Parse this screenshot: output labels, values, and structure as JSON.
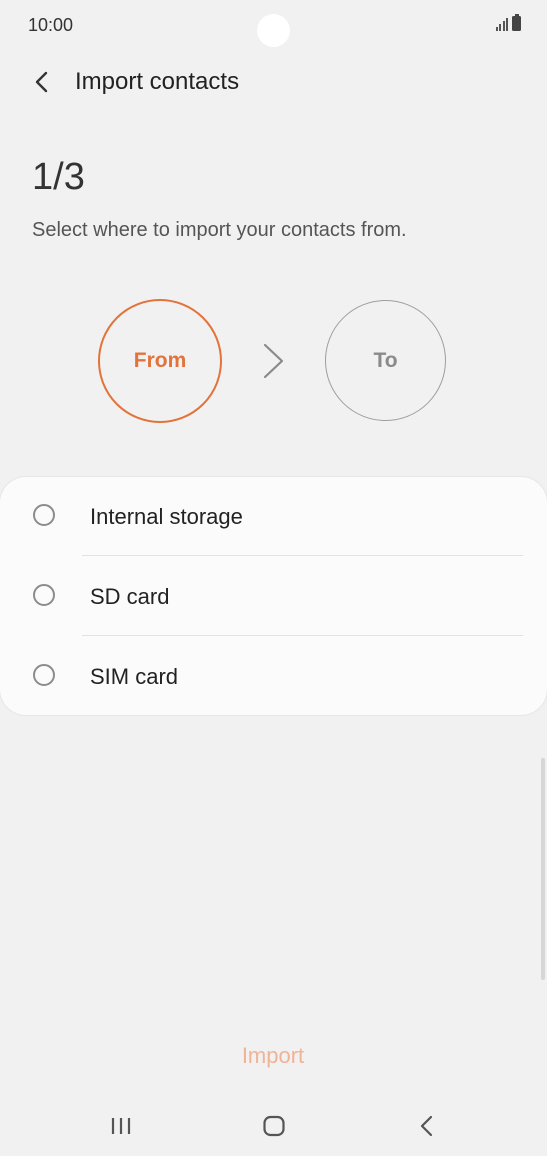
{
  "status_bar": {
    "time": "10:00",
    "signal_icon": "signal-bars-icon",
    "battery_icon": "battery-icon"
  },
  "header": {
    "title": "Import contacts",
    "back_icon": "back-arrow-icon"
  },
  "step": {
    "count": "1/3",
    "instruction": "Select where to import your contacts from."
  },
  "flow": {
    "from_label": "From",
    "to_label": "To",
    "arrow_icon": "chevron-right-icon",
    "accent_color": "#e2733b"
  },
  "options": [
    {
      "label": "Internal storage",
      "selected": false
    },
    {
      "label": "SD card",
      "selected": false
    },
    {
      "label": "SIM card",
      "selected": false
    }
  ],
  "footer": {
    "import_label": "Import",
    "import_enabled": false
  },
  "nav_bar": {
    "recent_icon": "recent-apps-icon",
    "home_icon": "home-icon",
    "back_icon": "nav-back-icon"
  }
}
